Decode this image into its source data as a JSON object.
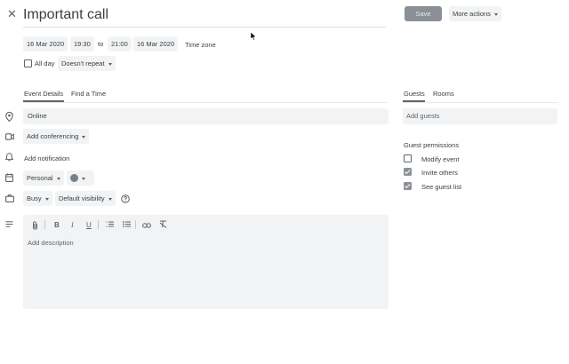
{
  "header": {
    "title": "Important call",
    "save_label": "Save",
    "more_actions_label": "More actions"
  },
  "datetime": {
    "start_date": "16 Mar 2020",
    "start_time": "19:30",
    "to_label": "to",
    "end_time": "21:00",
    "end_date": "16 Mar 2020",
    "timezone_label": "Time zone",
    "all_day_label": "All day",
    "repeat_label": "Doesn't repeat"
  },
  "tabs": {
    "event_details": "Event Details",
    "find_time": "Find a Time",
    "guests": "Guests",
    "rooms": "Rooms"
  },
  "details": {
    "location_value": "Online",
    "conferencing_label": "Add conferencing",
    "notification_label": "Add notification",
    "calendar_label": "Personal",
    "status_label": "Busy",
    "visibility_label": "Default visibility",
    "description_placeholder": "Add description"
  },
  "guests": {
    "add_placeholder": "Add guests",
    "permissions_title": "Guest permissions",
    "permissions": [
      {
        "label": "Modify event",
        "checked": false
      },
      {
        "label": "Invite others",
        "checked": true
      },
      {
        "label": "See guest list",
        "checked": true
      }
    ]
  },
  "colors": {
    "accent_tab": "#5f6368",
    "save_button": "#8a9096",
    "chip_bg": "#f1f3f4",
    "event_color": "#7a8088"
  }
}
